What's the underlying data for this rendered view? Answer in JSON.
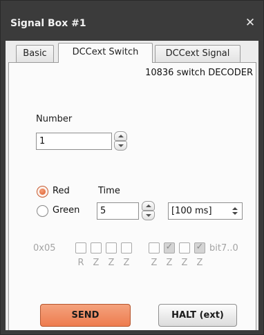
{
  "window": {
    "title": "Signal Box #1",
    "close_glyph": "✕"
  },
  "tabs": [
    {
      "label": "Basic",
      "active": false
    },
    {
      "label": "DCCext Switch",
      "active": true
    },
    {
      "label": "DCCext Signal",
      "active": false
    }
  ],
  "panel": {
    "decoder_label": "10836 switch DECODER",
    "number": {
      "label": "Number",
      "value": "1"
    },
    "aspect": {
      "options": [
        {
          "label": "Red",
          "selected": true
        },
        {
          "label": "Green",
          "selected": false
        }
      ]
    },
    "time": {
      "label": "Time",
      "value": "5",
      "unit_selected": "[100 ms]"
    },
    "bits": {
      "hex_value": "0x05",
      "suffix": "bit7..0",
      "checked": [
        false,
        false,
        false,
        false,
        false,
        true,
        false,
        true
      ],
      "letters": [
        "R",
        "Z",
        "Z",
        "Z",
        "Z",
        "Z",
        "Z",
        "Z"
      ]
    }
  },
  "buttons": {
    "send_label": "SEND",
    "halt_label": "HALT (ext)"
  },
  "colors": {
    "accent": "#ee7c4f",
    "titlebar": "#3b3b3b",
    "panel": "#fbfbfb"
  }
}
